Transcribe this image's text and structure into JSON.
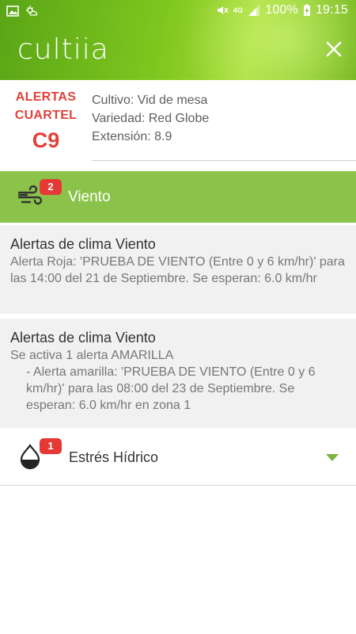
{
  "status_bar": {
    "battery": "100%",
    "time": "19:15",
    "network": "4G"
  },
  "app": {
    "logo_text": "cultiia"
  },
  "summary": {
    "line1": "ALERTAS",
    "line2": "CUARTEL",
    "code": "C9",
    "crop": "Cultivo: Vid de mesa",
    "variety": "Variedad: Red Globe",
    "extension": "Extensión: 8.9"
  },
  "sections": {
    "wind": {
      "label": "Viento",
      "badge": "2",
      "icon": "wind-icon",
      "color": "#8bc34a",
      "alerts": [
        {
          "title": "Alertas de clima Viento",
          "body": "Alerta Roja: 'PRUEBA DE VIENTO (Entre 0 y 6 km/hr)' para las 14:00 del 21 de Septiembre. Se esperan: 6.0 km/hr"
        },
        {
          "title": "Alertas de clima Viento",
          "body": "Se activa 1 alerta AMARILLA",
          "detail": "- Alerta amarilla: 'PRUEBA DE VIENTO (Entre 0 y 6 km/hr)' para las 08:00 del 23 de Septiembre. Se esperan: 6.0 km/hr en zona 1"
        }
      ]
    },
    "water_stress": {
      "label": "Estrés Hídrico",
      "badge": "1",
      "icon": "water-drop-icon"
    }
  },
  "colors": {
    "accent_green": "#8bc34a",
    "alert_red": "#e0423a",
    "badge_red": "#e53935"
  }
}
